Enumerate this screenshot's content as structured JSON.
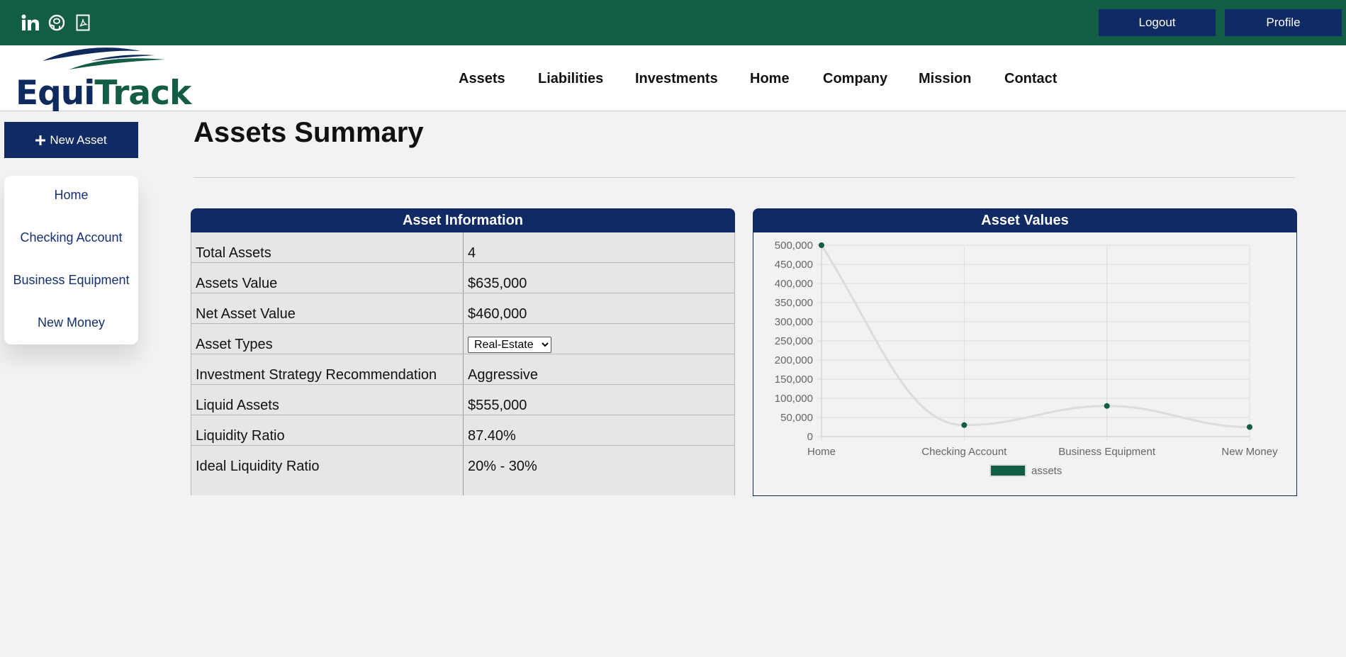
{
  "topbar": {
    "icons": [
      "linkedin-icon",
      "github-icon",
      "pdf-document-icon"
    ],
    "logout_label": "Logout",
    "profile_label": "Profile",
    "colors": {
      "topbar": "#135c45",
      "button": "#102a63"
    }
  },
  "logo": {
    "part1": "Equi",
    "part2": "Track"
  },
  "nav": {
    "items": [
      "Assets",
      "Liabilities",
      "Investments",
      "Home",
      "Company",
      "Mission",
      "Contact"
    ]
  },
  "sidebar": {
    "new_button_label": "New Asset",
    "items": [
      "Home",
      "Checking Account",
      "Business Equipment",
      "New Money"
    ]
  },
  "main": {
    "title": "Assets Summary",
    "info_panel": {
      "heading": "Asset Information",
      "rows": [
        {
          "label": "Total Assets",
          "value": "4"
        },
        {
          "label": "Assets Value",
          "value": "$635,000"
        },
        {
          "label": "Net Asset Value",
          "value": "$460,000"
        },
        {
          "label": "Asset Types",
          "value": "Real-Estate"
        },
        {
          "label": "Investment Strategy Recommendation",
          "value": "Aggressive"
        },
        {
          "label": "Liquid Assets",
          "value": "$555,000"
        },
        {
          "label": "Liquidity Ratio",
          "value": "87.40%"
        },
        {
          "label": "Ideal Liquidity Ratio",
          "value": "20% - 30%"
        }
      ],
      "asset_type_options": [
        "Real-Estate"
      ]
    },
    "chart_panel": {
      "heading": "Asset Values"
    }
  },
  "chart_data": {
    "type": "line",
    "categories": [
      "Home",
      "Checking Account",
      "Business Equipment",
      "New Money"
    ],
    "series": [
      {
        "name": "assets",
        "values": [
          500000,
          30000,
          80000,
          25000
        ],
        "color": "#135c45",
        "line_color": "#dcdcdc"
      }
    ],
    "yticks": [
      "0",
      "50,000",
      "100,000",
      "150,000",
      "200,000",
      "250,000",
      "300,000",
      "350,000",
      "400,000",
      "450,000",
      "500,000"
    ],
    "ylim": [
      0,
      500000
    ],
    "grid": true,
    "legend": "bottom"
  }
}
